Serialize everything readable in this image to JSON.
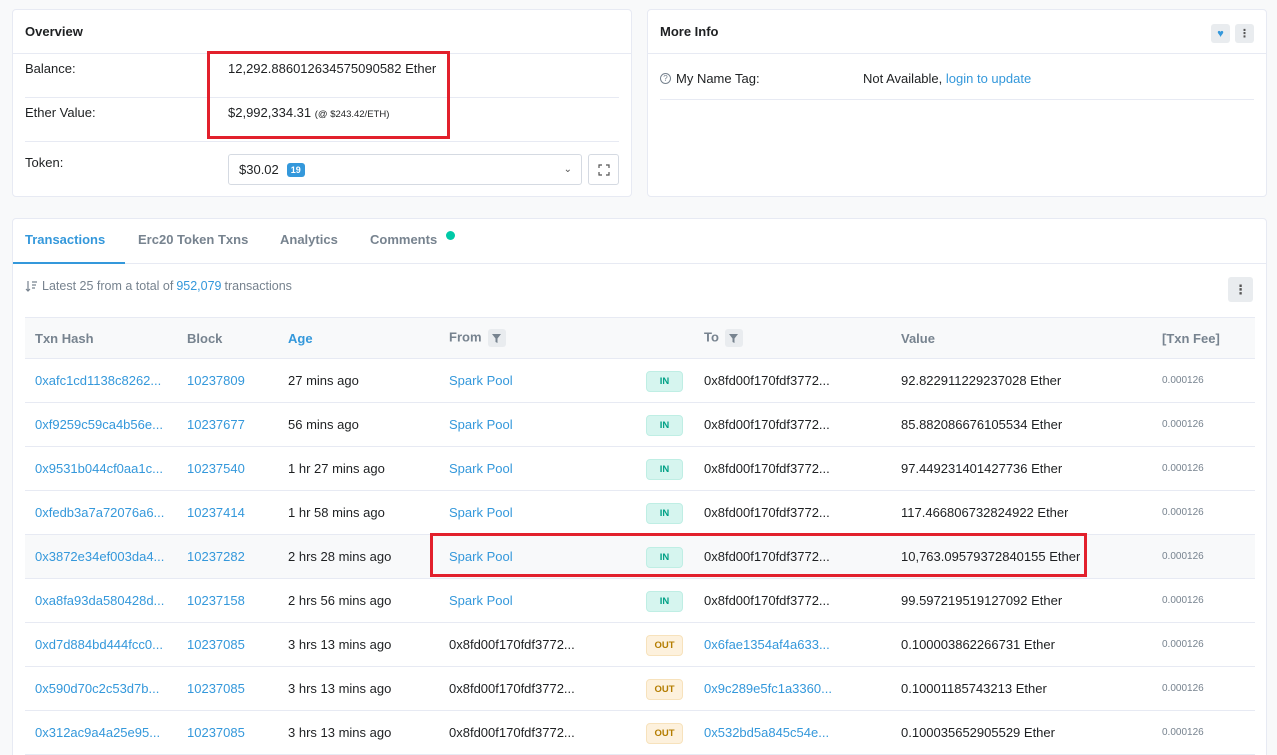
{
  "overview": {
    "title": "Overview",
    "balance_label": "Balance:",
    "balance_value": "12,292.886012634575090582 Ether",
    "ether_value_label": "Ether Value:",
    "ether_value": "$2,992,334.31",
    "ether_price": "(@ $243.42/ETH)",
    "token_label": "Token:",
    "token_value": "$30.02",
    "token_count": "19"
  },
  "more_info": {
    "title": "More Info",
    "name_tag_label": "My Name Tag:",
    "name_tag_value": "Not Available,",
    "login_link": "login to update"
  },
  "tabs": [
    {
      "label": "Transactions"
    },
    {
      "label": "Erc20 Token Txns"
    },
    {
      "label": "Analytics"
    },
    {
      "label": "Comments"
    }
  ],
  "summary": {
    "prefix": "Latest 25 from a total of",
    "total": "952,079",
    "suffix": "transactions"
  },
  "columns": {
    "hash": "Txn Hash",
    "block": "Block",
    "age": "Age",
    "from": "From",
    "to": "To",
    "value": "Value",
    "fee": "[Txn Fee]"
  },
  "rows": [
    {
      "hash": "0xafc1cd1138c8262...",
      "block": "10237809",
      "age": "27 mins ago",
      "from": "Spark Pool",
      "dir": "IN",
      "to": "0x8fd00f170fdf3772...",
      "value": "92.822911229237028 Ether",
      "fee": "0.000126"
    },
    {
      "hash": "0xf9259c59ca4b56e...",
      "block": "10237677",
      "age": "56 mins ago",
      "from": "Spark Pool",
      "dir": "IN",
      "to": "0x8fd00f170fdf3772...",
      "value": "85.882086676105534 Ether",
      "fee": "0.000126"
    },
    {
      "hash": "0x9531b044cf0aa1c...",
      "block": "10237540",
      "age": "1 hr 27 mins ago",
      "from": "Spark Pool",
      "dir": "IN",
      "to": "0x8fd00f170fdf3772...",
      "value": "97.449231401427736 Ether",
      "fee": "0.000126"
    },
    {
      "hash": "0xfedb3a7a72076a6...",
      "block": "10237414",
      "age": "1 hr 58 mins ago",
      "from": "Spark Pool",
      "dir": "IN",
      "to": "0x8fd00f170fdf3772...",
      "value": "117.466806732824922 Ether",
      "fee": "0.000126"
    },
    {
      "hash": "0x3872e34ef003da4...",
      "block": "10237282",
      "age": "2 hrs 28 mins ago",
      "from": "Spark Pool",
      "dir": "IN",
      "to": "0x8fd00f170fdf3772...",
      "value": "10,763.09579372840155 Ether",
      "fee": "0.000126"
    },
    {
      "hash": "0xa8fa93da580428d...",
      "block": "10237158",
      "age": "2 hrs 56 mins ago",
      "from": "Spark Pool",
      "dir": "IN",
      "to": "0x8fd00f170fdf3772...",
      "value": "99.597219519127092 Ether",
      "fee": "0.000126"
    },
    {
      "hash": "0xd7d884bd444fcc0...",
      "block": "10237085",
      "age": "3 hrs 13 mins ago",
      "from": "0x8fd00f170fdf3772...",
      "dir": "OUT",
      "to": "0x6fae1354af4a633...",
      "value": "0.100003862266731 Ether",
      "fee": "0.000126"
    },
    {
      "hash": "0x590d70c2c53d7b...",
      "block": "10237085",
      "age": "3 hrs 13 mins ago",
      "from": "0x8fd00f170fdf3772...",
      "dir": "OUT",
      "to": "0x9c289e5fc1a3360...",
      "value": "0.10001185743213 Ether",
      "fee": "0.000126"
    },
    {
      "hash": "0x312ac9a4a25e95...",
      "block": "10237085",
      "age": "3 hrs 13 mins ago",
      "from": "0x8fd00f170fdf3772...",
      "dir": "OUT",
      "to": "0x532bd5a845c54e...",
      "value": "0.100035652905529 Ether",
      "fee": "0.000126"
    }
  ],
  "colors": {
    "link": "#3498db",
    "highlight_box": "#e2202c",
    "in_badge": "#00a186",
    "out_badge": "#b47d00"
  }
}
